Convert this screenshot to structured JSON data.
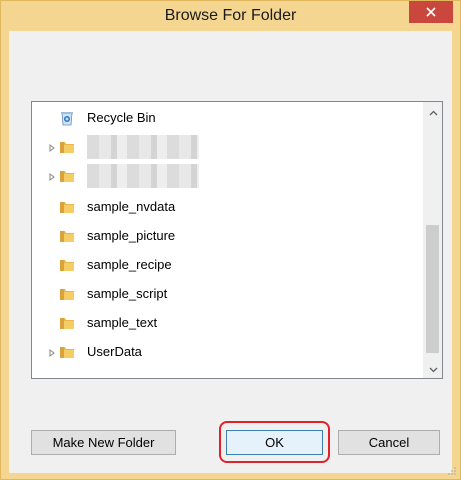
{
  "window": {
    "title": "Browse For Folder",
    "close_icon": "close-icon",
    "accent_color": "#f5d691",
    "close_color": "#c9473d"
  },
  "tree": {
    "items": [
      {
        "label": "Recycle Bin",
        "icon": "recycle-bin-icon",
        "expandable": false
      },
      {
        "label": "",
        "icon": "folder-icon",
        "expandable": true,
        "redacted": true
      },
      {
        "label": "",
        "icon": "folder-icon",
        "expandable": true,
        "redacted": true
      },
      {
        "label": "sample_nvdata",
        "icon": "folder-icon",
        "expandable": false
      },
      {
        "label": "sample_picture",
        "icon": "folder-icon",
        "expandable": false
      },
      {
        "label": "sample_recipe",
        "icon": "folder-icon",
        "expandable": false
      },
      {
        "label": "sample_script",
        "icon": "folder-icon",
        "expandable": false
      },
      {
        "label": "sample_text",
        "icon": "folder-icon",
        "expandable": false
      },
      {
        "label": "UserData",
        "icon": "folder-icon",
        "expandable": true
      }
    ]
  },
  "buttons": {
    "make_new_folder": "Make New Folder",
    "ok": "OK",
    "cancel": "Cancel"
  },
  "highlight_color": "#e0222a"
}
